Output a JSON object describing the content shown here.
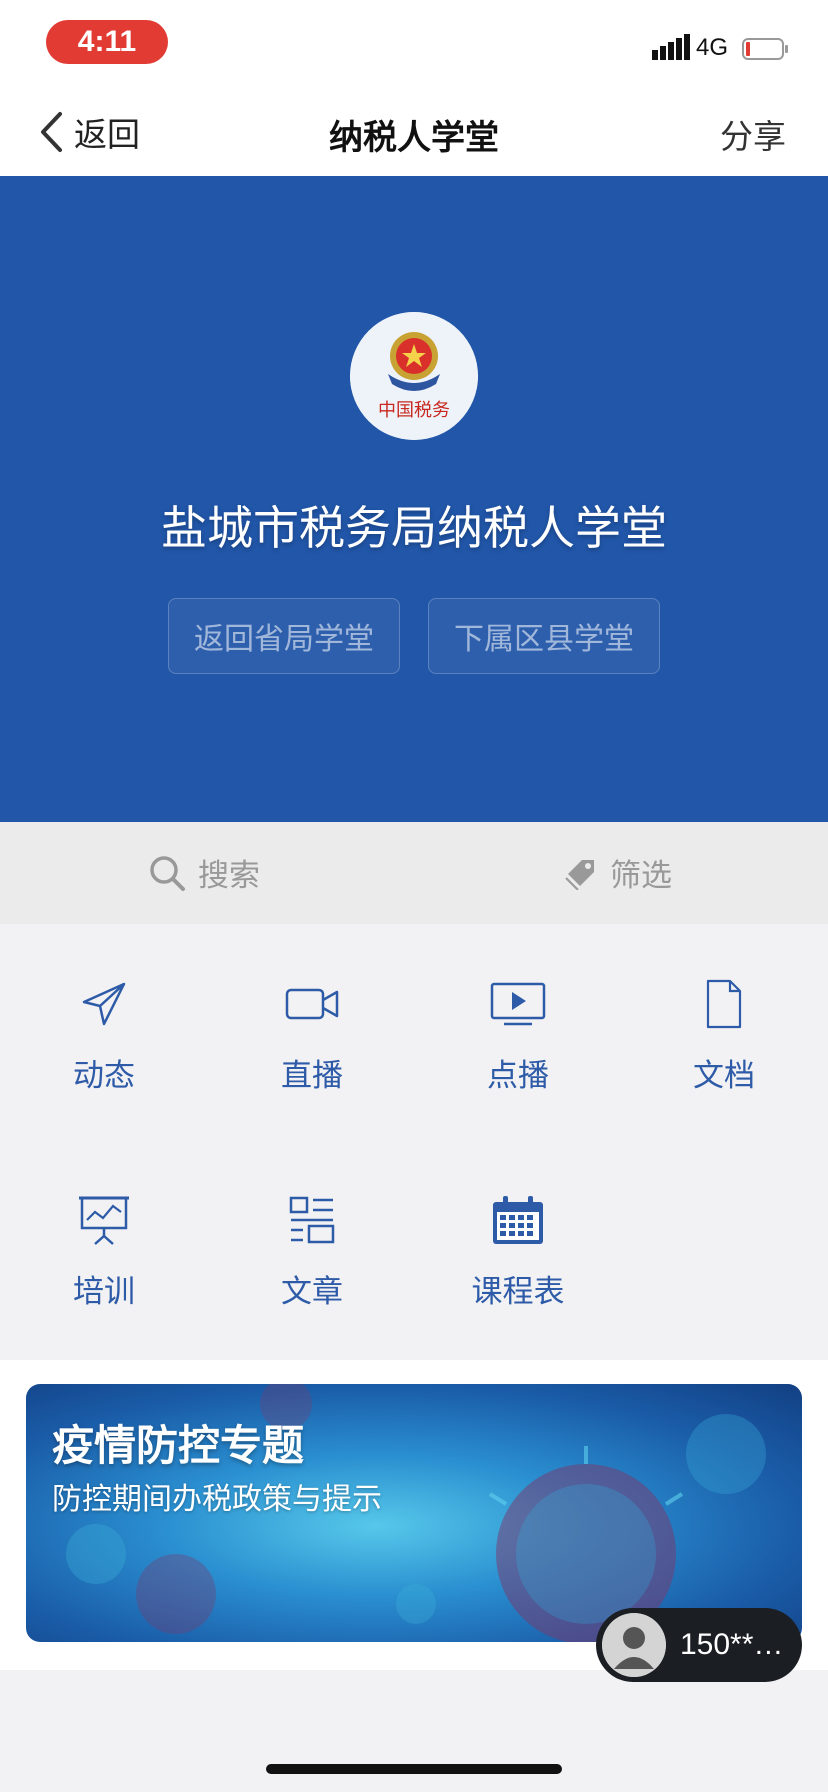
{
  "status_bar": {
    "time": "4:11",
    "network": "4G",
    "signal_icon": "signal-icon",
    "battery_icon": "battery-icon"
  },
  "nav": {
    "back_label": "返回",
    "title": "纳税人学堂",
    "share_label": "分享"
  },
  "hero": {
    "org_title": "盐城市税务局纳税人学堂",
    "buttons": [
      "返回省局学堂",
      "下属区县学堂"
    ],
    "background_color": "#2156a8",
    "logo_text": "中国税务"
  },
  "toolbar": {
    "search_label": "搜索",
    "filter_label": "筛选"
  },
  "grid": {
    "items": [
      {
        "label": "动态",
        "icon": "send-icon"
      },
      {
        "label": "直播",
        "icon": "video-camera-icon"
      },
      {
        "label": "点播",
        "icon": "play-screen-icon"
      },
      {
        "label": "文档",
        "icon": "document-icon"
      },
      {
        "label": "培训",
        "icon": "presentation-icon"
      },
      {
        "label": "文章",
        "icon": "article-icon"
      },
      {
        "label": "课程表",
        "icon": "calendar-icon"
      }
    ],
    "accent_color": "#2e5ba8"
  },
  "banner": {
    "title": "疫情防控专题",
    "subtitle": "防控期间办税政策与提示"
  },
  "user": {
    "name": "150**…"
  }
}
